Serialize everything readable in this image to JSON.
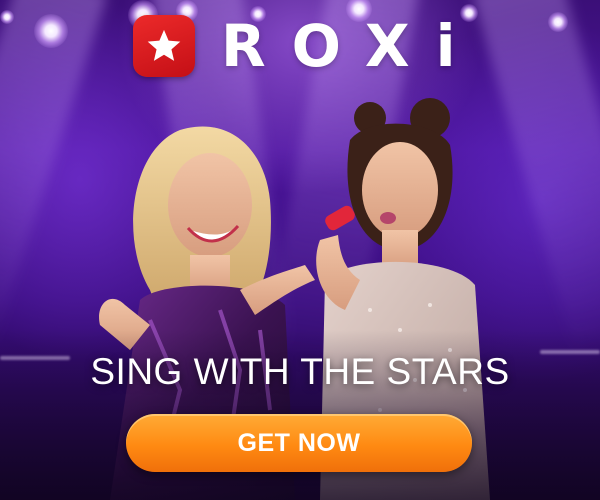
{
  "brand": {
    "name": "ROXi",
    "display_text": "ROXi",
    "logo_icon": "star-icon",
    "badge_color": "#e01e23"
  },
  "headline": "SING WITH THE STARS",
  "cta": {
    "label": "GET NOW",
    "color": "#ff9a1f"
  },
  "scene": {
    "background_color": "#3f108a",
    "image_description_icon": "two-singers-on-stage-image"
  }
}
